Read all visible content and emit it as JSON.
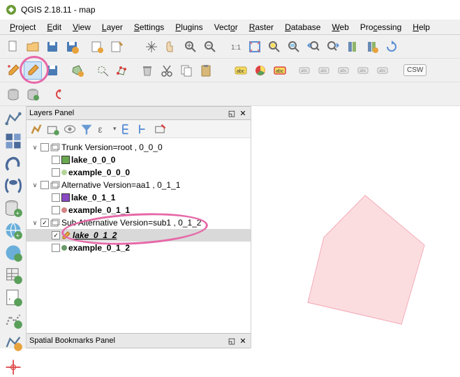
{
  "title": "QGIS 2.18.11 - map",
  "menu": [
    "Project",
    "Edit",
    "View",
    "Layer",
    "Settings",
    "Plugins",
    "Vector",
    "Raster",
    "Database",
    "Web",
    "Processing",
    "Help"
  ],
  "panels": {
    "layers_title": "Layers Panel",
    "bookmarks_title": "Spatial Bookmarks Panel"
  },
  "tree": {
    "g0": {
      "label": "Trunk Version=root , 0_0_0"
    },
    "g0_l0": {
      "label": "lake_0_0_0"
    },
    "g0_l1": {
      "label": "example_0_0_0"
    },
    "g1": {
      "label": "Alternative Version=aa1 , 0_1_1"
    },
    "g1_l0": {
      "label": "lake_0_1_1"
    },
    "g1_l1": {
      "label": "example_0_1_1"
    },
    "g2": {
      "label": "Sub Alternative Version=sub1 , 0_1_2"
    },
    "g2_l0": {
      "label": "lake_0_1_2"
    },
    "g2_l1": {
      "label": "example_0_1_2"
    }
  },
  "csw": "CSW"
}
